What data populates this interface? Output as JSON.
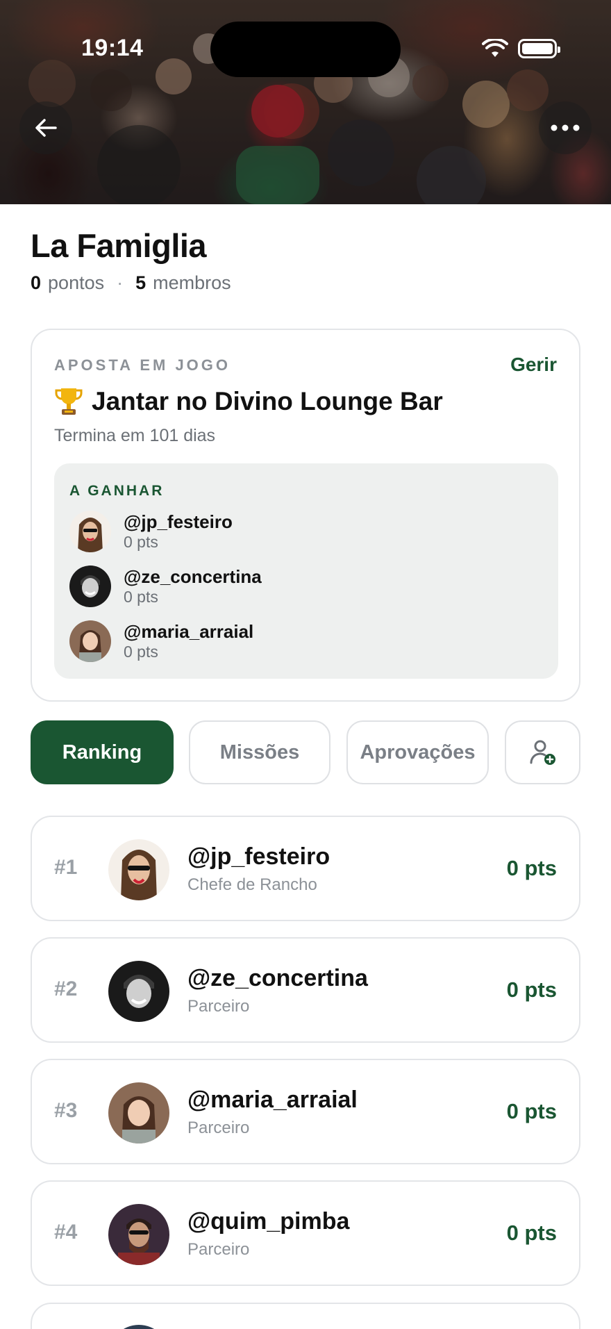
{
  "status_bar": {
    "time": "19:14"
  },
  "group": {
    "name": "La Famiglia",
    "points_value": "0",
    "points_label": "pontos",
    "separator": "·",
    "members_value": "5",
    "members_label": "membros"
  },
  "bet": {
    "eyebrow": "APOSTA EM JOGO",
    "manage_label": "Gerir",
    "title": "Jantar no Divino Lounge Bar",
    "subtitle": "Termina em 101 dias",
    "winners_eyebrow": "A GANHAR",
    "winners": [
      {
        "handle": "@jp_festeiro",
        "points": "0 pts"
      },
      {
        "handle": "@ze_concertina",
        "points": "0 pts"
      },
      {
        "handle": "@maria_arraial",
        "points": "0 pts"
      }
    ]
  },
  "tabs": [
    {
      "label": "Ranking",
      "active": true
    },
    {
      "label": "Missões",
      "active": false
    },
    {
      "label": "Aprovações",
      "active": false
    }
  ],
  "ranking": [
    {
      "position": "#1",
      "handle": "@jp_festeiro",
      "role": "Chefe de Rancho",
      "points": "0 pts"
    },
    {
      "position": "#2",
      "handle": "@ze_concertina",
      "role": "Parceiro",
      "points": "0 pts"
    },
    {
      "position": "#3",
      "handle": "@maria_arraial",
      "role": "Parceiro",
      "points": "0 pts"
    },
    {
      "position": "#4",
      "handle": "@quim_pimba",
      "role": "Parceiro",
      "points": "0 pts"
    }
  ],
  "icons": {
    "back": "arrow-left-icon",
    "more": "more-horizontal-icon",
    "trophy": "trophy-icon",
    "invite": "add-user-icon"
  },
  "colors": {
    "accent": "#1a5632",
    "muted_text": "#6b7076",
    "card_border": "#e3e5e8",
    "winners_bg": "#eef0ef"
  }
}
